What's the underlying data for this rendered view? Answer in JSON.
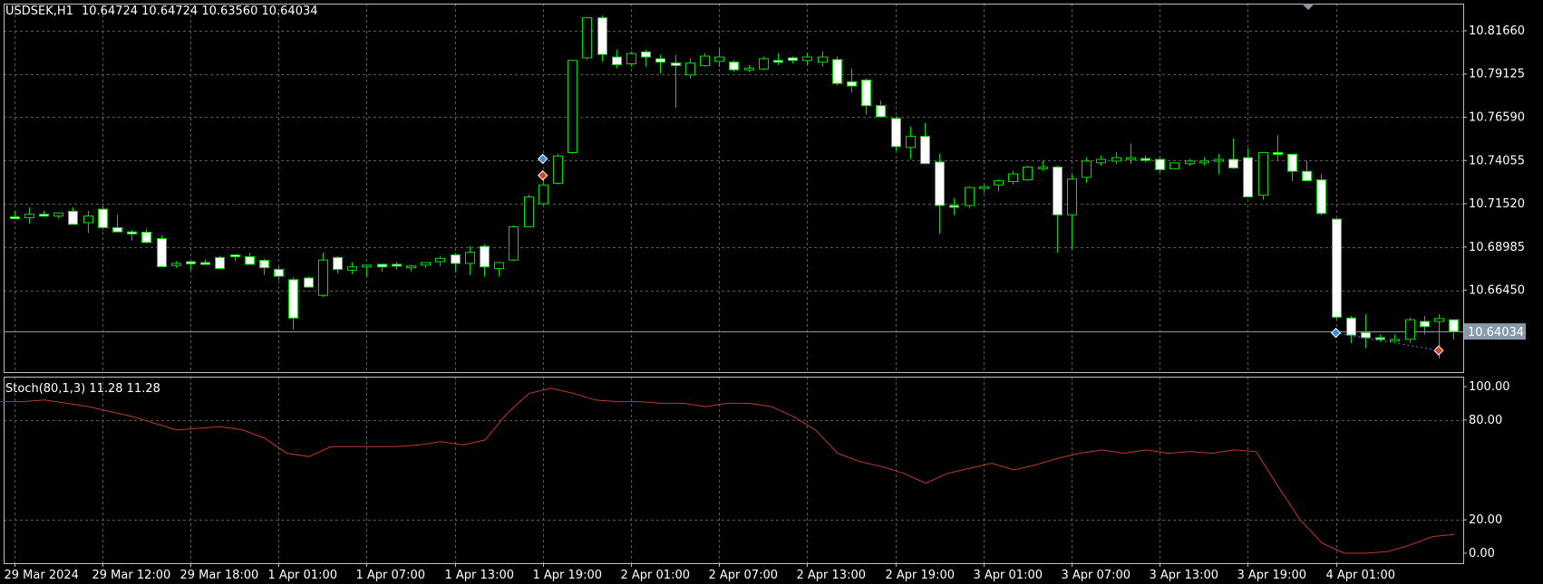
{
  "header": {
    "symbol": "USDSEK,H1",
    "ohlc": "10.64724 10.64724 10.63560 10.64034"
  },
  "indicator": {
    "label": "Stoch(80,1,3) 11.28 11.28"
  },
  "colors": {
    "background": "#000000",
    "grid": "#5a5a5a",
    "axis_line": "#bfbfbf",
    "wick": "#00dd00",
    "bull_body_fill": "#000000",
    "bull_body_border": "#00dd00",
    "bear_body_fill": "#ffffff",
    "stoch_line": "#c0392b",
    "bid_line": "#8a99aa",
    "price_tag_bg": "#8a99aa",
    "arrow_buy": "#3c8de0",
    "arrow_sell": "#e04020"
  },
  "chart_data": [
    {
      "type": "candlestick",
      "symbol": "USDSEK",
      "timeframe": "H1",
      "current_price": 10.64034,
      "current_price_label": "10.64034",
      "y_axis_labels": [
        "10.81660",
        "10.79125",
        "10.76590",
        "10.74055",
        "10.71520",
        "10.68985",
        "10.66450"
      ],
      "ylim": [
        10.6165,
        10.8325
      ],
      "grid": true,
      "x_axis_labels": [
        "29 Mar 2024",
        "29 Mar 12:00",
        "29 Mar 18:00",
        "1 Apr 01:00",
        "1 Apr 07:00",
        "1 Apr 13:00",
        "1 Apr 19:00",
        "2 Apr 01:00",
        "2 Apr 07:00",
        "2 Apr 13:00",
        "2 Apr 19:00",
        "3 Apr 01:00",
        "3 Apr 07:00",
        "3 Apr 13:00",
        "3 Apr 19:00",
        "4 Apr 01:00"
      ],
      "candles": [
        {
          "o": 10.7075,
          "h": 10.711,
          "l": 10.7065,
          "c": 10.707
        },
        {
          "o": 10.707,
          "h": 10.713,
          "l": 10.7035,
          "c": 10.709
        },
        {
          "o": 10.709,
          "h": 10.711,
          "l": 10.7075,
          "c": 10.708
        },
        {
          "o": 10.708,
          "h": 10.71,
          "l": 10.7065,
          "c": 10.7098
        },
        {
          "o": 10.7108,
          "h": 10.713,
          "l": 10.7035,
          "c": 10.7031
        },
        {
          "o": 10.7041,
          "h": 10.711,
          "l": 10.698,
          "c": 10.708
        },
        {
          "o": 10.712,
          "h": 10.7135,
          "l": 10.7,
          "c": 10.7012
        },
        {
          "o": 10.7012,
          "h": 10.709,
          "l": 10.6989,
          "c": 10.6987
        },
        {
          "o": 10.6987,
          "h": 10.7,
          "l": 10.6935,
          "c": 10.6975
        },
        {
          "o": 10.6985,
          "h": 10.7005,
          "l": 10.692,
          "c": 10.6925
        },
        {
          "o": 10.6948,
          "h": 10.6965,
          "l": 10.6785,
          "c": 10.6783
        },
        {
          "o": 10.679,
          "h": 10.6815,
          "l": 10.6775,
          "c": 10.6802
        },
        {
          "o": 10.6812,
          "h": 10.6815,
          "l": 10.6765,
          "c": 10.68
        },
        {
          "o": 10.6807,
          "h": 10.6825,
          "l": 10.6795,
          "c": 10.6802
        },
        {
          "o": 10.6837,
          "h": 10.6845,
          "l": 10.6775,
          "c": 10.6772
        },
        {
          "o": 10.6852,
          "h": 10.6855,
          "l": 10.6815,
          "c": 10.6842
        },
        {
          "o": 10.6842,
          "h": 10.6865,
          "l": 10.6795,
          "c": 10.6797
        },
        {
          "o": 10.682,
          "h": 10.683,
          "l": 10.6735,
          "c": 10.6777
        },
        {
          "o": 10.6767,
          "h": 10.6785,
          "l": 10.6705,
          "c": 10.6727
        },
        {
          "o": 10.6707,
          "h": 10.672,
          "l": 10.6415,
          "c": 10.6482
        },
        {
          "o": 10.6717,
          "h": 10.6725,
          "l": 10.6665,
          "c": 10.6663
        },
        {
          "o": 10.6615,
          "h": 10.6865,
          "l": 10.6605,
          "c": 10.6822
        },
        {
          "o": 10.6837,
          "h": 10.6845,
          "l": 10.6745,
          "c": 10.6767
        },
        {
          "o": 10.6762,
          "h": 10.681,
          "l": 10.674,
          "c": 10.6782
        },
        {
          "o": 10.6782,
          "h": 10.6795,
          "l": 10.6725,
          "c": 10.6792
        },
        {
          "o": 10.6797,
          "h": 10.6795,
          "l": 10.6755,
          "c": 10.6782
        },
        {
          "o": 10.6797,
          "h": 10.681,
          "l": 10.6765,
          "c": 10.6787
        },
        {
          "o": 10.6777,
          "h": 10.6795,
          "l": 10.6755,
          "c": 10.6787
        },
        {
          "o": 10.6792,
          "h": 10.6805,
          "l": 10.6775,
          "c": 10.6807
        },
        {
          "o": 10.6812,
          "h": 10.6845,
          "l": 10.6785,
          "c": 10.6832
        },
        {
          "o": 10.6852,
          "h": 10.6865,
          "l": 10.675,
          "c": 10.6802
        },
        {
          "o": 10.6802,
          "h": 10.6905,
          "l": 10.6735,
          "c": 10.6867
        },
        {
          "o": 10.6902,
          "h": 10.6915,
          "l": 10.6725,
          "c": 10.6782
        },
        {
          "o": 10.6772,
          "h": 10.681,
          "l": 10.6725,
          "c": 10.6807
        },
        {
          "o": 10.6822,
          "h": 10.7025,
          "l": 10.6815,
          "c": 10.7017
        },
        {
          "o": 10.7017,
          "h": 10.7205,
          "l": 10.7015,
          "c": 10.7192
        },
        {
          "o": 10.7152,
          "h": 10.7335,
          "l": 10.7145,
          "c": 10.7262
        },
        {
          "o": 10.7272,
          "h": 10.7445,
          "l": 10.7265,
          "c": 10.7432
        },
        {
          "o": 10.7452,
          "h": 10.7995,
          "l": 10.7445,
          "c": 10.7992
        },
        {
          "o": 10.8007,
          "h": 10.8245,
          "l": 10.7995,
          "c": 10.8242
        },
        {
          "o": 10.8242,
          "h": 10.8255,
          "l": 10.7985,
          "c": 10.8027
        },
        {
          "o": 10.8012,
          "h": 10.8055,
          "l": 10.7945,
          "c": 10.7967
        },
        {
          "o": 10.7972,
          "h": 10.8045,
          "l": 10.7955,
          "c": 10.8032
        },
        {
          "o": 10.8042,
          "h": 10.8055,
          "l": 10.7955,
          "c": 10.8012
        },
        {
          "o": 10.8002,
          "h": 10.8025,
          "l": 10.7915,
          "c": 10.7982
        },
        {
          "o": 10.7977,
          "h": 10.8025,
          "l": 10.7715,
          "c": 10.7962
        },
        {
          "o": 10.7907,
          "h": 10.8005,
          "l": 10.7885,
          "c": 10.7977
        },
        {
          "o": 10.7962,
          "h": 10.8035,
          "l": 10.7955,
          "c": 10.8017
        },
        {
          "o": 10.7987,
          "h": 10.8065,
          "l": 10.7955,
          "c": 10.8012
        },
        {
          "o": 10.7982,
          "h": 10.7995,
          "l": 10.7925,
          "c": 10.7937
        },
        {
          "o": 10.7937,
          "h": 10.7965,
          "l": 10.7925,
          "c": 10.7947
        },
        {
          "o": 10.7942,
          "h": 10.8015,
          "l": 10.7935,
          "c": 10.8002
        },
        {
          "o": 10.7992,
          "h": 10.8035,
          "l": 10.7965,
          "c": 10.7987
        },
        {
          "o": 10.8007,
          "h": 10.8015,
          "l": 10.7975,
          "c": 10.7992
        },
        {
          "o": 10.7992,
          "h": 10.8035,
          "l": 10.7965,
          "c": 10.8012
        },
        {
          "o": 10.7982,
          "h": 10.8045,
          "l": 10.7955,
          "c": 10.8012
        },
        {
          "o": 10.7997,
          "h": 10.8015,
          "l": 10.7845,
          "c": 10.7857
        },
        {
          "o": 10.7867,
          "h": 10.7945,
          "l": 10.7805,
          "c": 10.7842
        },
        {
          "o": 10.7877,
          "h": 10.7885,
          "l": 10.7675,
          "c": 10.7727
        },
        {
          "o": 10.7727,
          "h": 10.7755,
          "l": 10.7675,
          "c": 10.7662
        },
        {
          "o": 10.7652,
          "h": 10.7665,
          "l": 10.7462,
          "c": 10.7487
        },
        {
          "o": 10.7482,
          "h": 10.7605,
          "l": 10.7415,
          "c": 10.7547
        },
        {
          "o": 10.7547,
          "h": 10.7625,
          "l": 10.7385,
          "c": 10.7387
        },
        {
          "o": 10.7397,
          "h": 10.7445,
          "l": 10.6975,
          "c": 10.7142
        },
        {
          "o": 10.7142,
          "h": 10.7185,
          "l": 10.7085,
          "c": 10.7137
        },
        {
          "o": 10.7142,
          "h": 10.7255,
          "l": 10.7125,
          "c": 10.7247
        },
        {
          "o": 10.7242,
          "h": 10.7265,
          "l": 10.7215,
          "c": 10.7252
        },
        {
          "o": 10.7262,
          "h": 10.7295,
          "l": 10.7225,
          "c": 10.7287
        },
        {
          "o": 10.7282,
          "h": 10.7345,
          "l": 10.7265,
          "c": 10.7327
        },
        {
          "o": 10.7292,
          "h": 10.7375,
          "l": 10.7285,
          "c": 10.7367
        },
        {
          "o": 10.7362,
          "h": 10.7405,
          "l": 10.7345,
          "c": 10.7367
        },
        {
          "o": 10.7367,
          "h": 10.7375,
          "l": 10.6865,
          "c": 10.7087
        },
        {
          "o": 10.7087,
          "h": 10.7322,
          "l": 10.6885,
          "c": 10.7297
        },
        {
          "o": 10.7307,
          "h": 10.7425,
          "l": 10.7275,
          "c": 10.7402
        },
        {
          "o": 10.7392,
          "h": 10.7435,
          "l": 10.7375,
          "c": 10.7412
        },
        {
          "o": 10.7402,
          "h": 10.7455,
          "l": 10.7385,
          "c": 10.7422
        },
        {
          "o": 10.7412,
          "h": 10.7505,
          "l": 10.7385,
          "c": 10.7422
        },
        {
          "o": 10.7417,
          "h": 10.7435,
          "l": 10.7395,
          "c": 10.7412
        },
        {
          "o": 10.7412,
          "h": 10.7425,
          "l": 10.7335,
          "c": 10.7352
        },
        {
          "o": 10.7357,
          "h": 10.7395,
          "l": 10.7355,
          "c": 10.7392
        },
        {
          "o": 10.7387,
          "h": 10.7415,
          "l": 10.7375,
          "c": 10.7402
        },
        {
          "o": 10.7392,
          "h": 10.7425,
          "l": 10.7375,
          "c": 10.7402
        },
        {
          "o": 10.7402,
          "h": 10.7445,
          "l": 10.7325,
          "c": 10.7412
        },
        {
          "o": 10.7412,
          "h": 10.7535,
          "l": 10.7355,
          "c": 10.7362
        },
        {
          "o": 10.7422,
          "h": 10.7475,
          "l": 10.7285,
          "c": 10.7192
        },
        {
          "o": 10.7202,
          "h": 10.7445,
          "l": 10.7175,
          "c": 10.7452
        },
        {
          "o": 10.7452,
          "h": 10.7555,
          "l": 10.7405,
          "c": 10.7442
        },
        {
          "o": 10.7442,
          "h": 10.7445,
          "l": 10.7285,
          "c": 10.7342
        },
        {
          "o": 10.7342,
          "h": 10.7405,
          "l": 10.7285,
          "c": 10.7287
        },
        {
          "o": 10.7292,
          "h": 10.7325,
          "l": 10.7085,
          "c": 10.7095
        },
        {
          "o": 10.7062,
          "h": 10.7065,
          "l": 10.6475,
          "c": 10.6487
        },
        {
          "o": 10.6482,
          "h": 10.6495,
          "l": 10.6335,
          "c": 10.6382
        },
        {
          "o": 10.6397,
          "h": 10.6505,
          "l": 10.6305,
          "c": 10.6367
        },
        {
          "o": 10.6367,
          "h": 10.6385,
          "l": 10.6345,
          "c": 10.6357
        },
        {
          "o": 10.6357,
          "h": 10.6385,
          "l": 10.6345,
          "c": 10.6357
        },
        {
          "o": 10.6357,
          "h": 10.6485,
          "l": 10.6335,
          "c": 10.6472
        },
        {
          "o": 10.6462,
          "h": 10.6495,
          "l": 10.6385,
          "c": 10.6432
        },
        {
          "o": 10.6462,
          "h": 10.6505,
          "l": 10.6245,
          "c": 10.6479
        },
        {
          "o": 10.6472,
          "h": 10.6472,
          "l": 10.6356,
          "c": 10.6403
        }
      ],
      "trade_markers": [
        {
          "candle": 36,
          "price": 10.7415,
          "kind": "buy"
        },
        {
          "candle": 36,
          "price": 10.7318,
          "kind": "sell"
        },
        {
          "candle": 90,
          "price": 10.6395,
          "kind": "buy"
        },
        {
          "candle": 97,
          "price": 10.6292,
          "kind": "sell"
        }
      ]
    },
    {
      "type": "line",
      "name": "Stoch(80,1,3)",
      "ylim": [
        -6,
        106
      ],
      "y_axis_labels": [
        "100.00",
        "80.00",
        "20.00",
        "0.00"
      ],
      "levels": [
        80,
        20
      ],
      "series": [
        {
          "name": "Stoch(80,1,3)",
          "values": [
            91,
            91,
            92,
            90,
            88,
            85,
            82,
            78,
            74,
            75,
            76,
            74,
            69,
            60,
            58,
            64,
            64,
            64,
            64,
            65,
            67,
            65,
            68,
            84,
            96,
            99,
            96,
            92,
            91,
            91,
            90,
            90,
            88,
            90,
            90,
            88,
            82,
            74,
            60,
            55,
            52,
            48,
            42,
            48,
            51,
            54,
            50,
            53,
            57,
            60,
            62,
            60,
            62,
            60,
            61,
            60,
            62,
            61,
            40,
            20,
            6,
            0,
            0,
            1,
            5,
            10,
            11.28
          ]
        }
      ]
    }
  ]
}
